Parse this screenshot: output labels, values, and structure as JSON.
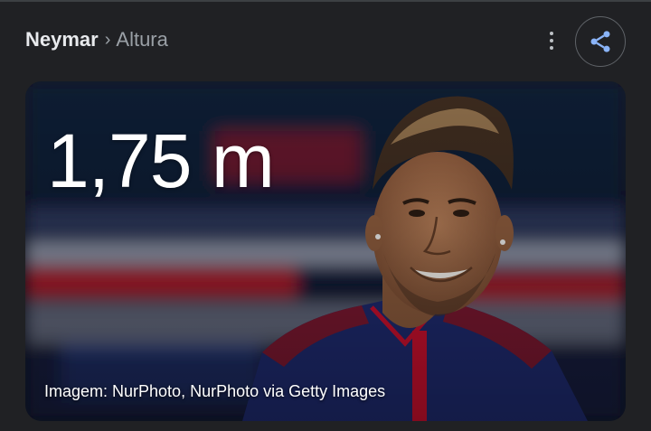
{
  "breadcrumb": {
    "root": "Neymar",
    "separator": "›",
    "leaf": "Altura"
  },
  "actions": {
    "more_icon": "more-vert-icon",
    "share_icon": "share-icon"
  },
  "card": {
    "height_value": "1,75 m",
    "image_credit": "Imagem: NurPhoto, NurPhoto via Getty Images"
  },
  "colors": {
    "background": "#202124",
    "share_icon": "#8ab4f8",
    "jersey_navy": "#1e2a6e",
    "jersey_red": "#c8102e"
  }
}
